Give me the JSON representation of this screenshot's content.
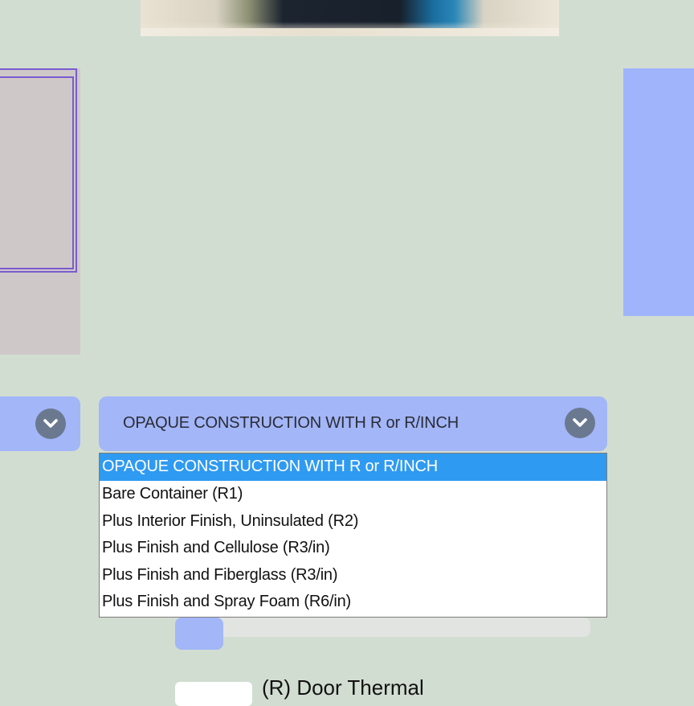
{
  "main_select": {
    "label": "OPAQUE CONSTRUCTION WITH R or R/INCH",
    "chevron_icon": "chevron-down-icon"
  },
  "left_select": {
    "chevron_icon": "chevron-down-icon"
  },
  "dropdown": {
    "options": [
      {
        "label": "OPAQUE CONSTRUCTION WITH R or R/INCH",
        "selected": true
      },
      {
        "label": "Bare Container (R1)",
        "selected": false
      },
      {
        "label": "Plus Interior Finish, Uninsulated (R2)",
        "selected": false
      },
      {
        "label": "Plus Finish and Cellulose (R3/in)",
        "selected": false
      },
      {
        "label": "Plus Finish and Fiberglass (R3/in)",
        "selected": false
      },
      {
        "label": "Plus Finish and Spray Foam (R6/in)",
        "selected": false
      }
    ]
  },
  "door_thermal": {
    "label": "(R) Door Thermal"
  },
  "colors": {
    "background": "#d2ddd1",
    "select_bg": "#a2b6f8",
    "highlight": "#2f9af1",
    "chevron_circle": "#6b7990"
  }
}
